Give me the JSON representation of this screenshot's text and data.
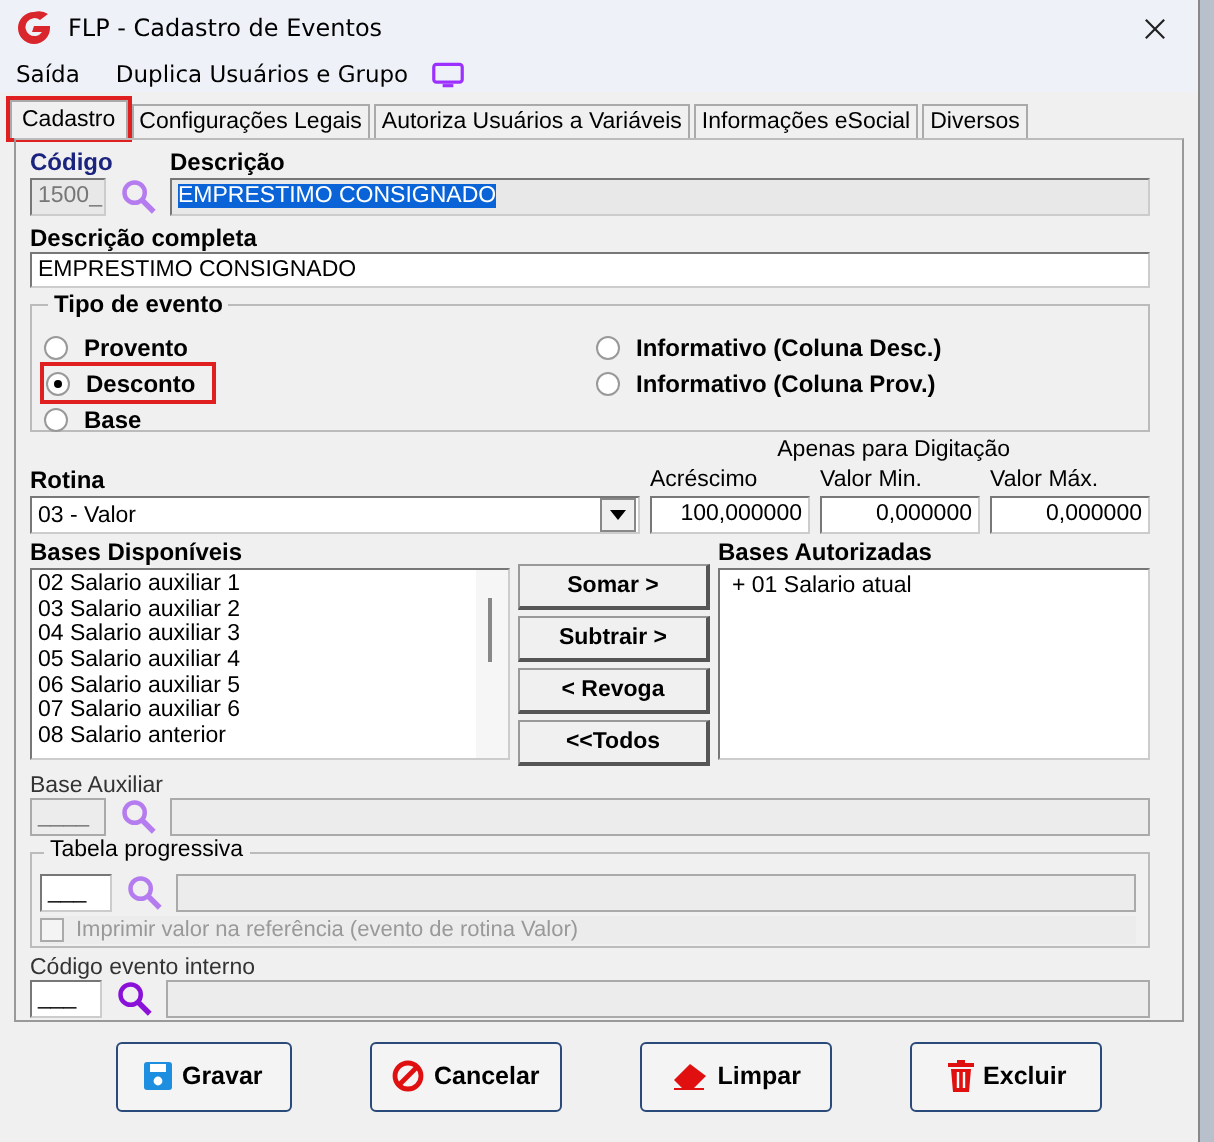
{
  "window": {
    "title": "FLP - Cadastro de Eventos"
  },
  "menu": [
    {
      "label": "Saída"
    },
    {
      "label": "Duplica Usuários e Grupo"
    }
  ],
  "tabs": [
    {
      "label": "Cadastro",
      "selected": true,
      "highlighted": true
    },
    {
      "label": "Configurações Legais",
      "selected": false,
      "highlighted": false
    },
    {
      "label": "Autoriza Usuários a Variáveis",
      "selected": false,
      "highlighted": false
    },
    {
      "label": "Informações eSocial",
      "selected": false,
      "highlighted": false
    },
    {
      "label": "Diversos",
      "selected": false,
      "highlighted": false
    }
  ],
  "codigo": {
    "label": "Código",
    "value": "1500_",
    "disabled": true
  },
  "descricao": {
    "label": "Descrição",
    "value": "EMPRESTIMO CONSIGNADO",
    "text_selected": true
  },
  "descricao_completa": {
    "label": "Descrição completa",
    "value": "EMPRESTIMO CONSIGNADO"
  },
  "tipo_evento": {
    "title": "Tipo de evento",
    "left_options": [
      {
        "label": "Provento",
        "selected": false,
        "highlighted": false
      },
      {
        "label": "Desconto",
        "selected": true,
        "highlighted": true
      },
      {
        "label": "Base",
        "selected": false,
        "highlighted": false
      }
    ],
    "right_options": [
      {
        "label": "Informativo (Coluna Desc.)",
        "selected": false,
        "highlighted": false
      },
      {
        "label": "Informativo (Coluna Prov.)",
        "selected": false,
        "highlighted": false
      }
    ]
  },
  "rotina": {
    "label": "Rotina",
    "value": "03 - Valor"
  },
  "digitacao_caption": "Apenas para Digitação",
  "acrescimo": {
    "label": "Acréscimo",
    "value": "100,000000"
  },
  "valor_min": {
    "label": "Valor Min.",
    "value": "0,000000"
  },
  "valor_max": {
    "label": "Valor Máx.",
    "value": "0,000000"
  },
  "bases_disponiveis": {
    "title": "Bases Disponíveis",
    "items": [
      "02 Salario auxiliar 1",
      "03 Salario auxiliar 2",
      "04 Salario auxiliar 3",
      "05 Salario auxiliar 4",
      "06 Salario auxiliar 5",
      "07 Salario auxiliar 6",
      "08 Salario anterior"
    ]
  },
  "transfer_buttons": [
    "Somar >",
    "Subtrair >",
    "< Revoga",
    "<<Todos"
  ],
  "bases_autorizadas": {
    "title": "Bases Autorizadas",
    "items": [
      "+ 01 Salario atual"
    ]
  },
  "base_auxiliar": {
    "label": "Base Auxiliar",
    "code": "____",
    "disabled": true
  },
  "tabela_progressiva": {
    "title": "Tabela progressiva",
    "code": "___",
    "checkbox": {
      "label": "Imprimir valor na referência (evento de rotina Valor)",
      "checked": false,
      "disabled": true
    }
  },
  "codigo_evento_interno": {
    "label": "Código evento interno",
    "code": "___"
  },
  "actions": [
    {
      "label": "Gravar",
      "kind": "save"
    },
    {
      "label": "Cancelar",
      "kind": "cancel"
    },
    {
      "label": "Limpar",
      "kind": "clear"
    },
    {
      "label": "Excluir",
      "kind": "delete"
    }
  ]
}
